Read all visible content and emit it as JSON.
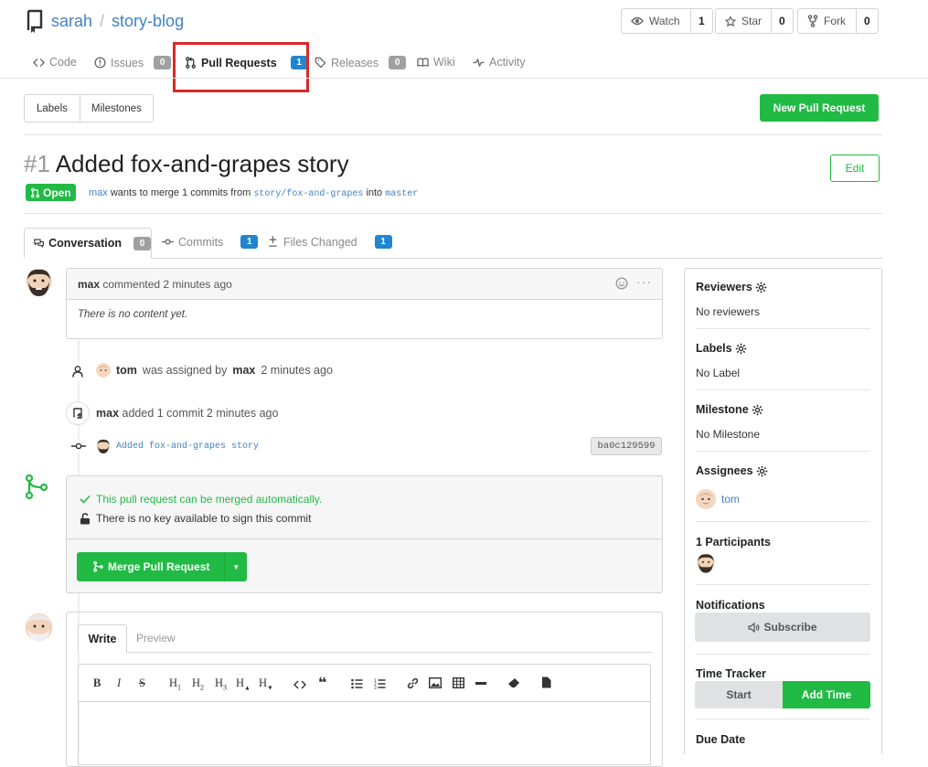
{
  "repo": {
    "owner": "sarah",
    "separator": "/",
    "name": "story-blog"
  },
  "repo_actions": [
    {
      "label": "Watch",
      "count": "1",
      "icon": "eye-icon"
    },
    {
      "label": "Star",
      "count": "0",
      "icon": "star-icon"
    },
    {
      "label": "Fork",
      "count": "0",
      "icon": "fork-icon"
    }
  ],
  "nav_tabs": [
    {
      "label": "Code",
      "icon": "code-icon"
    },
    {
      "label": "Issues",
      "badge": "0",
      "icon": "issue-icon"
    },
    {
      "label": "Pull Requests",
      "badge": "1",
      "icon": "pull-request-icon",
      "active": true
    },
    {
      "label": "Releases",
      "badge": "0",
      "icon": "tag-icon"
    },
    {
      "label": "Wiki",
      "icon": "book-icon"
    },
    {
      "label": "Activity",
      "icon": "pulse-icon"
    }
  ],
  "filters": {
    "labels": "Labels",
    "milestones": "Milestones"
  },
  "new_pr_button": "New Pull Request",
  "pr": {
    "number": "#1",
    "title": "Added fox-and-grapes story",
    "state": "Open",
    "author": "max",
    "merge_text": "wants to merge 1 commits from",
    "head_branch": "story/fox-and-grapes",
    "into_text": "into",
    "base_branch": "master",
    "edit_button": "Edit"
  },
  "pr_tabs": [
    {
      "label": "Conversation",
      "badge": "0",
      "icon": "comments-icon",
      "active": true
    },
    {
      "label": "Commits",
      "badge": "1",
      "icon": "commit-icon"
    },
    {
      "label": "Files Changed",
      "badge": "1",
      "icon": "diff-icon"
    }
  ],
  "comment": {
    "author": "max",
    "action": "commented 2 minutes ago",
    "body": "There is no content yet."
  },
  "timeline": {
    "assign": {
      "assignee": "tom",
      "middle": "was assigned by",
      "assigner": "max",
      "time": "2 minutes ago"
    },
    "commit_event": {
      "user": "max",
      "text": "added 1 commit 2 minutes ago"
    },
    "commit": {
      "message": "Added fox-and-grapes story",
      "sha": "ba0c129599"
    }
  },
  "merge": {
    "status": "This pull request can be merged automatically.",
    "sign": "There is no key available to sign this commit",
    "button": "Merge Pull Request",
    "status_color": "#21ba45"
  },
  "editor": {
    "tabs": [
      "Write",
      "Preview"
    ],
    "toolbar": [
      "B",
      "I",
      "S",
      "H",
      "H",
      "H",
      "H",
      "H"
    ],
    "heading_subs": [
      "1",
      "2",
      "3",
      "▲",
      "▼"
    ]
  },
  "sidebar": {
    "reviewers": {
      "title": "Reviewers",
      "value": "No reviewers"
    },
    "labels": {
      "title": "Labels",
      "value": "No Label"
    },
    "milestone": {
      "title": "Milestone",
      "value": "No Milestone"
    },
    "assignees": {
      "title": "Assignees",
      "user": "tom"
    },
    "participants": {
      "title": "1 Participants"
    },
    "notifications": {
      "title": "Notifications",
      "button": "Subscribe"
    },
    "time_tracker": {
      "title": "Time Tracker",
      "start": "Start",
      "add": "Add Time"
    },
    "due_date": {
      "title": "Due Date"
    }
  },
  "colors": {
    "accent": "#21ba45",
    "link": "#4183c4",
    "badge_blue": "#2185d0",
    "highlight": "#db2828"
  }
}
